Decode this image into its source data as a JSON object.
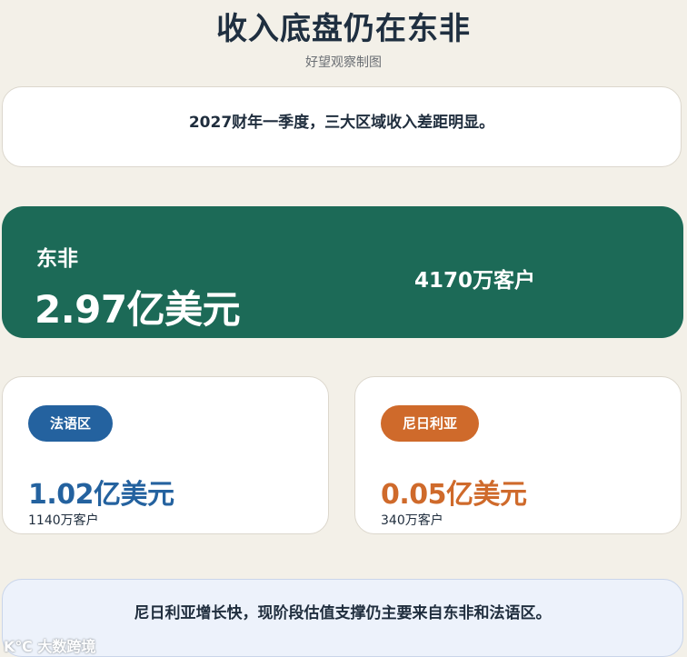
{
  "header": {
    "title": "收入底盘仍在东非",
    "subtitle": "好望观察制图"
  },
  "intro": {
    "text": "2027财年一季度，三大区域收入差距明显。"
  },
  "hero": {
    "name": "东非",
    "value": "2.97亿美元",
    "customers": "4170万客户"
  },
  "regions": [
    {
      "name": "法语区",
      "value": "1.02亿美元",
      "customers": "1140万客户"
    },
    {
      "name": "尼日利亚",
      "value": "0.05亿美元",
      "customers": "340万客户"
    }
  ],
  "outro": {
    "text": "尼日利亚增长快，现阶段估值支撑仍主要来自东非和法语区。"
  },
  "watermark": {
    "text": "K℃ 大数跨境"
  },
  "colors": {
    "background": "#f3f0e8",
    "hero": "#1c6a57",
    "francophone": "#24629f",
    "nigeria": "#cf6a2b",
    "outro_bg": "#edf2fb"
  }
}
